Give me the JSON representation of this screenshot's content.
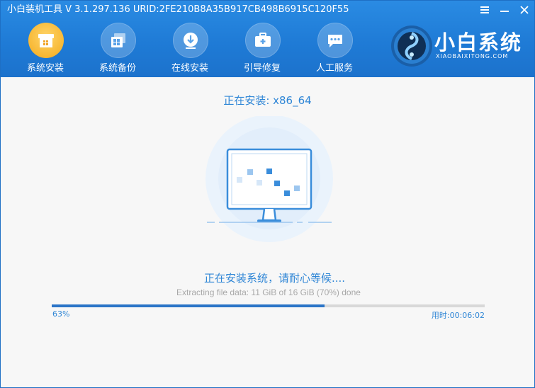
{
  "window": {
    "title": "小白装机工具 V 3.1.297.136 URID:2FE210B8A35B917CB498B6915C120F55"
  },
  "nav": {
    "items": [
      {
        "label": "系统安装",
        "icon": "install-box-icon",
        "active": true
      },
      {
        "label": "系统备份",
        "icon": "backup-windows-icon",
        "active": false
      },
      {
        "label": "在线安装",
        "icon": "download-icon",
        "active": false
      },
      {
        "label": "引导修复",
        "icon": "toolbox-icon",
        "active": false
      },
      {
        "label": "人工服务",
        "icon": "chat-icon",
        "active": false
      }
    ]
  },
  "brand": {
    "name": "小白系统",
    "url": "XIAOBAIXITONG.COM"
  },
  "install": {
    "title": "正在安装: x86_64",
    "status": "正在安装系统，请耐心等候....",
    "detail": "Extracting file data: 11 GiB of 16 GiB (70%) done",
    "progress_fraction": 0.63,
    "percent_label": "63%",
    "elapsed_label": "用时:00:06:02"
  },
  "colors": {
    "header_blue": "#1f7bd6",
    "accent_blue": "#2f86d6",
    "progress_blue": "#2b74c7",
    "active_icon_orange": "#f7b733"
  }
}
